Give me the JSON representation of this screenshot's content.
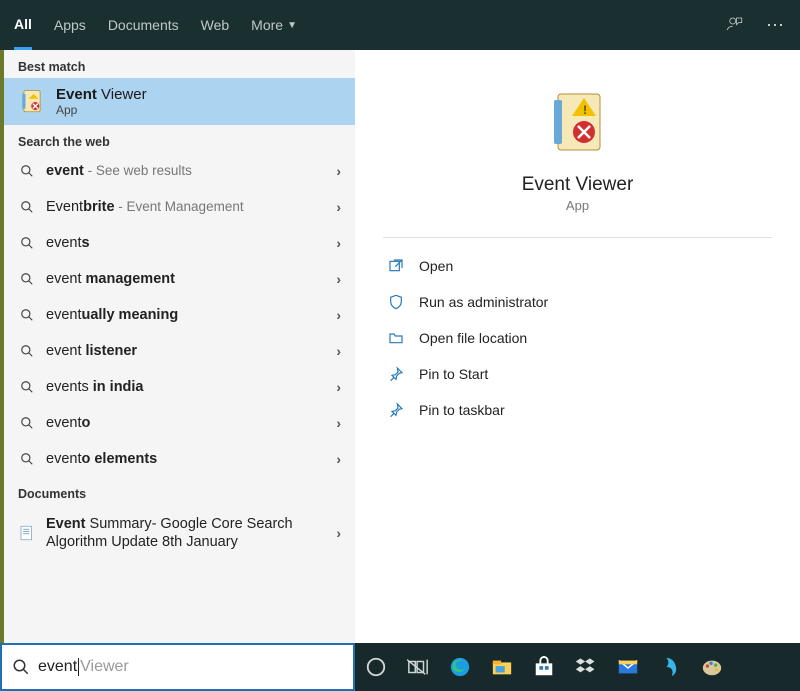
{
  "tabs": {
    "all": "All",
    "apps": "Apps",
    "documents": "Documents",
    "web": "Web",
    "more": "More"
  },
  "sections": {
    "best_match": "Best match",
    "search_web": "Search the web",
    "documents": "Documents"
  },
  "best_match": {
    "title_bold": "Event",
    "title_rest": " Viewer",
    "subtitle": "App"
  },
  "web_results": [
    {
      "bold": "event",
      "rest": "",
      "hint": " - See web results"
    },
    {
      "bold": "Event",
      "rest": "brite",
      "hint": " - Event Management",
      "bold_prefix": "",
      "label_pre": "",
      "display": "Eventbrite"
    },
    {
      "bold": "event",
      "rest": "s",
      "hint": ""
    },
    {
      "bold": "event ",
      "rest": "management",
      "hint": "",
      "bold_suffix": true
    },
    {
      "bold": "event",
      "rest": "ually meaning",
      "hint": "",
      "bold_suffix": true
    },
    {
      "bold": "event ",
      "rest": "listener",
      "hint": "",
      "bold_suffix": true
    },
    {
      "bold": "event",
      "rest": "s in india",
      "hint": "",
      "bold_suffix": true
    },
    {
      "bold": "event",
      "rest": "o",
      "hint": "",
      "bold_suffix": true
    },
    {
      "bold": "event",
      "rest": "o elements",
      "hint": "",
      "bold_suffix": true
    }
  ],
  "document_result": {
    "bold": "Event",
    "rest": " Summary- Google Core Search Algorithm Update 8th January"
  },
  "preview": {
    "title": "Event Viewer",
    "subtitle": "App",
    "actions": {
      "open": "Open",
      "run_admin": "Run as administrator",
      "open_loc": "Open file location",
      "pin_start": "Pin to Start",
      "pin_taskbar": "Pin to taskbar"
    }
  },
  "search": {
    "typed": "event",
    "ghost": " Viewer"
  }
}
